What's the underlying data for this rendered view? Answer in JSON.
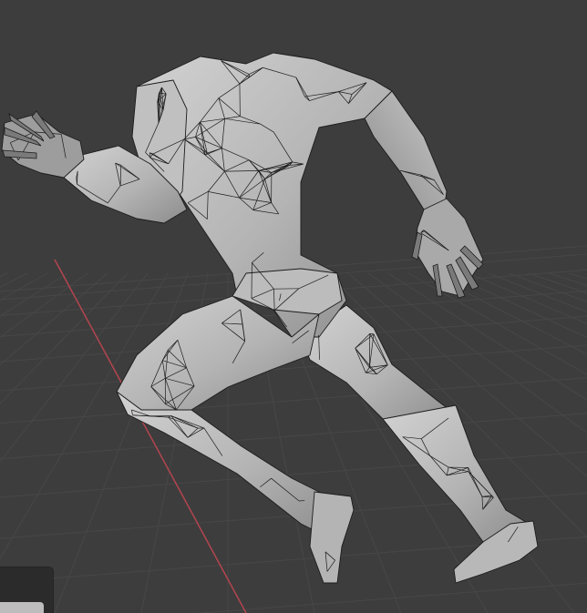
{
  "app": {
    "view": "3D Viewport",
    "shading_mode": "solid-wireframe",
    "object": "runner-mesh"
  },
  "colors": {
    "background": "#3d3d3d",
    "grid_line": "#474747",
    "x_axis": "#b3454f",
    "mesh_light": "#c8c8c8",
    "mesh_mid": "#a8a8a8",
    "mesh_dark": "#7d7d7d",
    "wire": "#1c1c1c"
  },
  "icons": {
    "panel": "collapsed-panel-icon"
  }
}
